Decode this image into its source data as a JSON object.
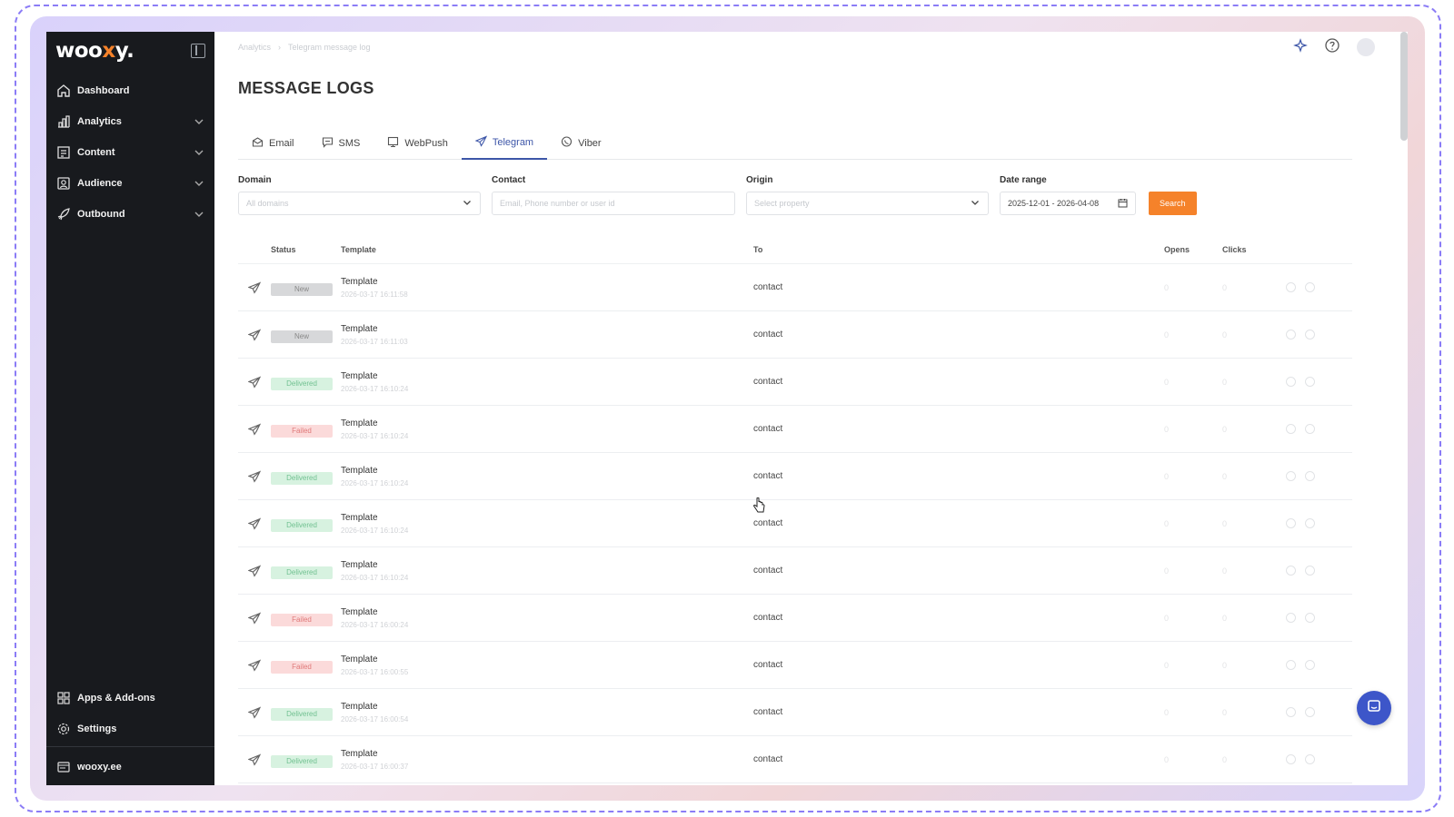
{
  "app": {
    "logo_prefix": "woo",
    "logo_x": "x",
    "logo_suffix": "y.",
    "brand_color": "#f5822a",
    "accent_color": "#3d56a8"
  },
  "sidebar": {
    "items": [
      {
        "label": "Dashboard",
        "icon": "home-icon"
      },
      {
        "label": "Analytics",
        "icon": "bar-chart-icon"
      },
      {
        "label": "Content",
        "icon": "content-icon"
      },
      {
        "label": "Audience",
        "icon": "audience-icon"
      },
      {
        "label": "Outbound",
        "icon": "rocket-icon"
      }
    ],
    "bottom": [
      {
        "label": "Apps & Add-ons",
        "icon": "apps-grid-icon"
      },
      {
        "label": "Settings",
        "icon": "gear-icon"
      }
    ],
    "domain": "wooxy.ee"
  },
  "header": {
    "breadcrumb": [
      "Analytics",
      "Telegram message log"
    ],
    "title": "MESSAGE LOGS"
  },
  "tabs": [
    {
      "label": "Email",
      "icon": "envelope-icon"
    },
    {
      "label": "SMS",
      "icon": "sms-icon"
    },
    {
      "label": "WebPush",
      "icon": "webpush-icon"
    },
    {
      "label": "Telegram",
      "icon": "telegram-icon"
    },
    {
      "label": "Viber",
      "icon": "viber-icon"
    }
  ],
  "filters": {
    "domain_label": "Domain",
    "domain_value": "All domains",
    "contact_label": "Contact",
    "contact_placeholder": "Email, Phone number or user id",
    "origin_label": "Origin",
    "origin_value": "Select property",
    "date_label": "Date range",
    "date_value": "2025-12-01 - 2026-04-08",
    "search_label": "Search"
  },
  "table": {
    "headers": {
      "status": "Status",
      "template": "Template",
      "to": "To",
      "opens": "Opens",
      "clicks": "Clicks"
    },
    "rows": [
      {
        "status": "New",
        "kind": "new",
        "template": "Template",
        "date": "2026-03-17 16:11:58",
        "to": "contact",
        "opens": "0",
        "clicks": "0"
      },
      {
        "status": "New",
        "kind": "new",
        "template": "Template",
        "date": "2026-03-17 16:11:03",
        "to": "contact",
        "opens": "0",
        "clicks": "0"
      },
      {
        "status": "Delivered",
        "kind": "delivered",
        "template": "Template",
        "date": "2026-03-17 16:10:24",
        "to": "contact",
        "opens": "0",
        "clicks": "0"
      },
      {
        "status": "Failed",
        "kind": "failed",
        "template": "Template",
        "date": "2026-03-17 16:10:24",
        "to": "contact",
        "opens": "0",
        "clicks": "0"
      },
      {
        "status": "Delivered",
        "kind": "delivered",
        "template": "Template",
        "date": "2026-03-17 16:10:24",
        "to": "contact",
        "opens": "0",
        "clicks": "0"
      },
      {
        "status": "Delivered",
        "kind": "delivered",
        "template": "Template",
        "date": "2026-03-17 16:10:24",
        "to": "contact",
        "opens": "0",
        "clicks": "0"
      },
      {
        "status": "Delivered",
        "kind": "delivered",
        "template": "Template",
        "date": "2026-03-17 16:10:24",
        "to": "contact",
        "opens": "0",
        "clicks": "0"
      },
      {
        "status": "Failed",
        "kind": "failed",
        "template": "Template",
        "date": "2026-03-17 16:00:24",
        "to": "contact",
        "opens": "0",
        "clicks": "0"
      },
      {
        "status": "Failed",
        "kind": "failed",
        "template": "Template",
        "date": "2026-03-17 16:00:55",
        "to": "contact",
        "opens": "0",
        "clicks": "0"
      },
      {
        "status": "Delivered",
        "kind": "delivered",
        "template": "Template",
        "date": "2026-03-17 16:00:54",
        "to": "contact",
        "opens": "0",
        "clicks": "0"
      },
      {
        "status": "Delivered",
        "kind": "delivered",
        "template": "Template",
        "date": "2026-03-17 16:00:37",
        "to": "contact",
        "opens": "0",
        "clicks": "0"
      }
    ]
  }
}
